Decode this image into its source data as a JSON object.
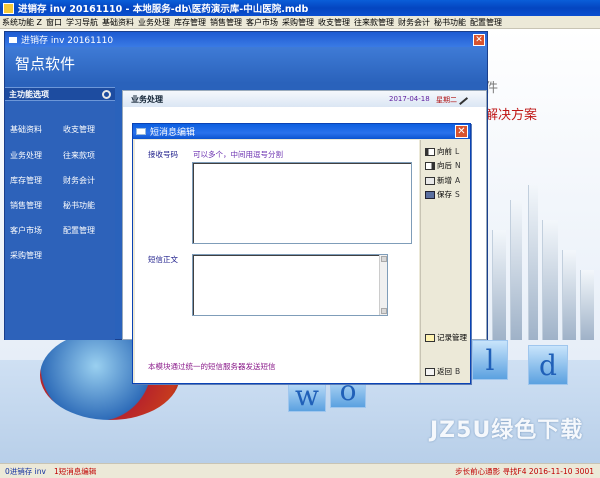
{
  "app": {
    "title": "进销存 inv 20161110 - 本地服务-db\\医药演示库-中山医院.mdb"
  },
  "menu": [
    "系统功能 Z",
    "窗口",
    "学习导航",
    "基础资料",
    "业务处理",
    "库存管理",
    "销售管理",
    "客户市场",
    "采购管理",
    "收支管理",
    "往来款管理",
    "财务会计",
    "秘书功能",
    "配置管理"
  ],
  "background": {
    "banner_top": "件",
    "banner_bottom": "解决方案",
    "word_letters": [
      "w",
      "o",
      "l",
      "d"
    ],
    "watermark": "JZ5U绿色下载"
  },
  "inner_window": {
    "title": "进销存 inv 20161110",
    "product_name": "智点软件",
    "sidebar_header": "主功能选项",
    "sidebar_items": [
      "基础资料",
      "收支管理",
      "业务处理",
      "往来款项",
      "库存管理",
      "财务会计",
      "销售管理",
      "秘书功能",
      "客户市场",
      "配置管理",
      "采购管理"
    ],
    "content_title": "业务处理",
    "date": "2017-04-18",
    "week": "星期二"
  },
  "dialog": {
    "title": "短消息编辑",
    "recipient_label": "接收号码",
    "recipient_hint": "可以多个，中间用逗号分割",
    "body_label": "短信正文",
    "footer_text": "本模块通过统一的短信服务器发送短信",
    "buttons": [
      {
        "label": "向前",
        "key": "L",
        "icon": "prev-icon"
      },
      {
        "label": "向后",
        "key": "N",
        "icon": "next-icon"
      },
      {
        "label": "新增",
        "key": "A",
        "icon": "new-icon"
      },
      {
        "label": "保存",
        "key": "S",
        "icon": "save-icon"
      }
    ],
    "record_button": "记录管理",
    "back_button": "返回",
    "back_key": "B"
  },
  "status": {
    "left1": "0进销存 inv",
    "left2": "1短消息编辑",
    "right": "步长前心通影  寻找F4  2016-11-10  3001"
  }
}
